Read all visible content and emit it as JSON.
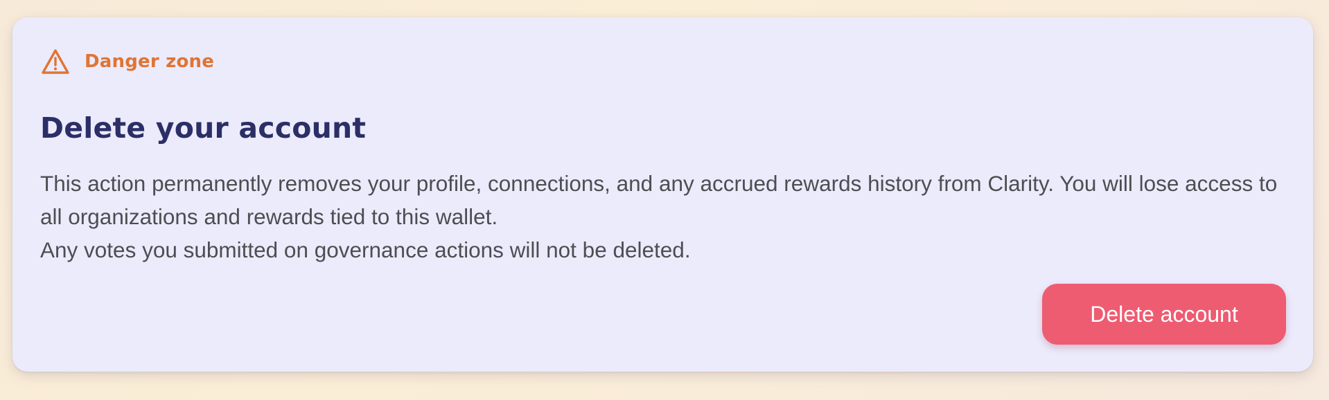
{
  "danger_zone": {
    "icon": "warning-triangle-icon",
    "label": "Danger zone",
    "accent_color": "#e07434"
  },
  "delete_section": {
    "title": "Delete your account",
    "description_1": "This action permanently removes your profile, connections, and any accrued rewards history from Clarity. You will lose access to all organizations and rewards tied to this wallet.",
    "description_2": "Any votes you submitted on governance actions will not be deleted.",
    "button_label": "Delete account",
    "button_color": "#ee5c72"
  }
}
